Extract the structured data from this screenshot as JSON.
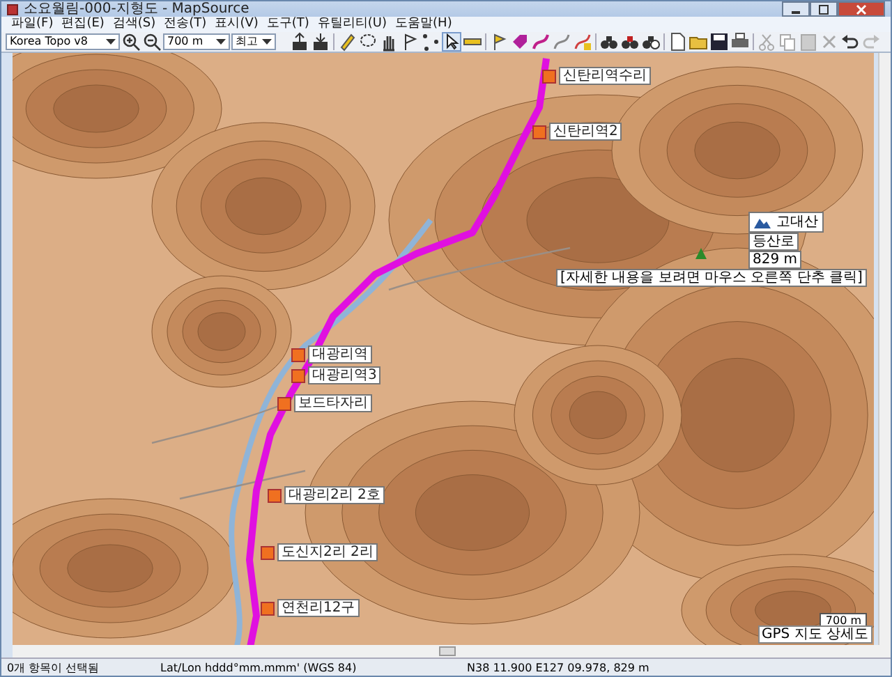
{
  "window": {
    "title": "소요월림-000-지형도 - MapSource"
  },
  "menu": [
    {
      "label": "파일(F)"
    },
    {
      "label": "편집(E)"
    },
    {
      "label": "검색(S)"
    },
    {
      "label": "전송(T)"
    },
    {
      "label": "표시(V)"
    },
    {
      "label": "도구(T)"
    },
    {
      "label": "유틸리티(U)"
    },
    {
      "label": "도움말(H)"
    }
  ],
  "toolbar": {
    "map_product": "Korea Topo v8",
    "zoom": "700 m",
    "detail": "최고"
  },
  "map": {
    "waypoints": [
      {
        "label": "신탄리역수리"
      },
      {
        "label": "신탄리역2"
      },
      {
        "label": "대광리역"
      },
      {
        "label": "대광리역3"
      },
      {
        "label": "보드타자리"
      },
      {
        "label": "대광리2리 2호"
      },
      {
        "label": "도신지2리 2리"
      },
      {
        "label": "연천리12구"
      }
    ],
    "tooltip": {
      "title": "고대산",
      "lines": [
        "등산로",
        "829 m"
      ],
      "hint": "[자세한 내용을 보려면 마우스 오른쪽 단추 클릭]"
    },
    "scale": "700 m",
    "detail_label": "GPS 지도 상세도"
  },
  "status_bar": {
    "selection": "0개 항목이 선택됨",
    "format": "Lat/Lon hddd°mm.mmm' (WGS 84)",
    "position": "N38 11.900 E127 09.978, 829 m"
  }
}
